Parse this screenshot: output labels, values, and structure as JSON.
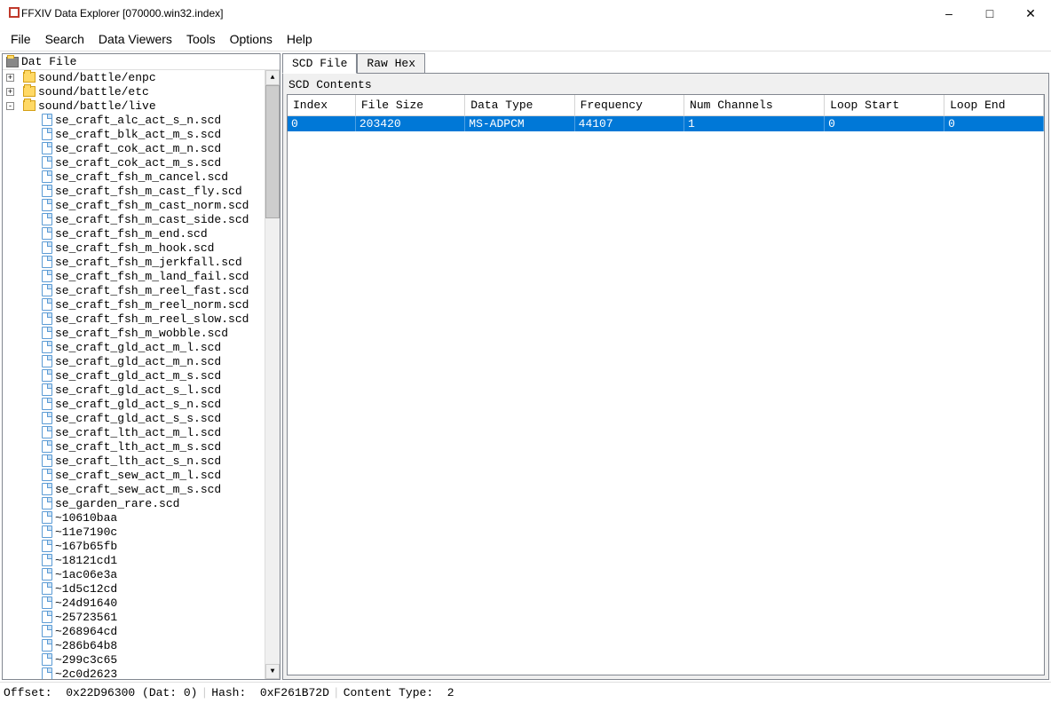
{
  "titlebar": {
    "text": "FFXIV Data Explorer [070000.win32.index]"
  },
  "menubar": {
    "items": [
      "File",
      "Search",
      "Data Viewers",
      "Tools",
      "Options",
      "Help"
    ]
  },
  "tree": {
    "header": "Dat File",
    "folders": [
      {
        "name": "sound/battle/enpc",
        "expanded": false
      },
      {
        "name": "sound/battle/etc",
        "expanded": false
      },
      {
        "name": "sound/battle/live",
        "expanded": true
      }
    ],
    "files": [
      "se_craft_alc_act_s_n.scd",
      "se_craft_blk_act_m_s.scd",
      "se_craft_cok_act_m_n.scd",
      "se_craft_cok_act_m_s.scd",
      "se_craft_fsh_m_cancel.scd",
      "se_craft_fsh_m_cast_fly.scd",
      "se_craft_fsh_m_cast_norm.scd",
      "se_craft_fsh_m_cast_side.scd",
      "se_craft_fsh_m_end.scd",
      "se_craft_fsh_m_hook.scd",
      "se_craft_fsh_m_jerkfall.scd",
      "se_craft_fsh_m_land_fail.scd",
      "se_craft_fsh_m_reel_fast.scd",
      "se_craft_fsh_m_reel_norm.scd",
      "se_craft_fsh_m_reel_slow.scd",
      "se_craft_fsh_m_wobble.scd",
      "se_craft_gld_act_m_l.scd",
      "se_craft_gld_act_m_n.scd",
      "se_craft_gld_act_m_s.scd",
      "se_craft_gld_act_s_l.scd",
      "se_craft_gld_act_s_n.scd",
      "se_craft_gld_act_s_s.scd",
      "se_craft_lth_act_m_l.scd",
      "se_craft_lth_act_m_s.scd",
      "se_craft_lth_act_s_n.scd",
      "se_craft_sew_act_m_l.scd",
      "se_craft_sew_act_m_s.scd",
      "se_garden_rare.scd",
      "~10610baa",
      "~11e7190c",
      "~167b65fb",
      "~18121cd1",
      "~1ac06e3a",
      "~1d5c12cd",
      "~24d91640",
      "~25723561",
      "~268964cd",
      "~286b64b8",
      "~299c3c65",
      "~2c0d2623"
    ]
  },
  "tabs": {
    "items": [
      "SCD File",
      "Raw Hex"
    ],
    "active": 0
  },
  "content": {
    "panel_label": "SCD Contents",
    "columns": [
      "Index",
      "File Size",
      "Data Type",
      "Frequency",
      "Num Channels",
      "Loop Start",
      "Loop End"
    ],
    "rows": [
      {
        "index": "0",
        "file_size": "203420",
        "data_type": "MS-ADPCM",
        "frequency": "44107",
        "num_channels": "1",
        "loop_start": "0",
        "loop_end": "0"
      }
    ]
  },
  "statusbar": {
    "offset_label": "Offset:",
    "offset_value": "0x22D96300 (Dat: 0)",
    "hash_label": "Hash:",
    "hash_value": "0xF261B72D",
    "content_type_label": "Content Type:",
    "content_type_value": "2"
  }
}
